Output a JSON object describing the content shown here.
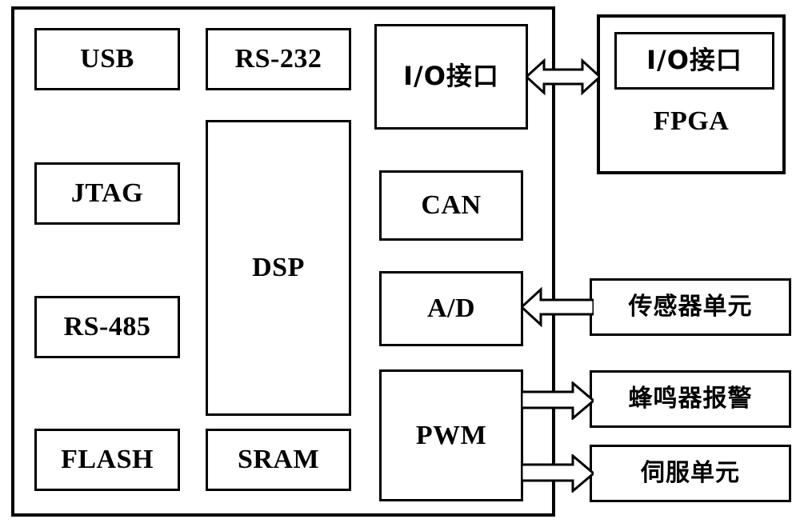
{
  "diagram": {
    "title": "DSP control board block diagram",
    "stroke_color": "#000000",
    "background_color": "#ffffff",
    "boards": [
      {
        "name": "main-board",
        "label": ""
      },
      {
        "name": "fpga-board",
        "label": "FPGA"
      }
    ],
    "blocks": [
      {
        "id": "usb",
        "label": "USB",
        "lang": "en"
      },
      {
        "id": "rs232",
        "label": "RS-232",
        "lang": "en"
      },
      {
        "id": "io_main",
        "label": "I/O接口",
        "lang": "cn"
      },
      {
        "id": "io_fpga",
        "label": "I/O接口",
        "lang": "cn"
      },
      {
        "id": "fpga",
        "label": "FPGA",
        "lang": "en"
      },
      {
        "id": "jtag",
        "label": "JTAG",
        "lang": "en"
      },
      {
        "id": "dsp",
        "label": "DSP",
        "lang": "en"
      },
      {
        "id": "can",
        "label": "CAN",
        "lang": "en"
      },
      {
        "id": "rs485",
        "label": "RS-485",
        "lang": "en"
      },
      {
        "id": "ad",
        "label": "A/D",
        "lang": "en"
      },
      {
        "id": "sensor",
        "label": "传感器单元",
        "lang": "cn"
      },
      {
        "id": "flash",
        "label": "FLASH",
        "lang": "en"
      },
      {
        "id": "sram",
        "label": "SRAM",
        "lang": "en"
      },
      {
        "id": "pwm",
        "label": "PWM",
        "lang": "en"
      },
      {
        "id": "buzzer",
        "label": "蜂鸣器报警",
        "lang": "cn"
      },
      {
        "id": "servo",
        "label": "伺服单元",
        "lang": "cn"
      }
    ],
    "connections": [
      {
        "from": "io_main",
        "to": "io_fpga",
        "direction": "bidirectional"
      },
      {
        "from": "sensor",
        "to": "ad",
        "direction": "left"
      },
      {
        "from": "pwm",
        "to": "buzzer",
        "direction": "right"
      },
      {
        "from": "pwm",
        "to": "servo",
        "direction": "right"
      }
    ]
  }
}
